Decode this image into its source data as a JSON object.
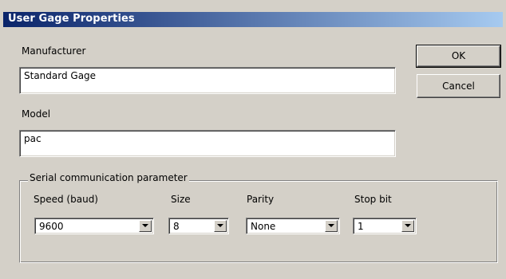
{
  "window": {
    "title": "User Gage Properties"
  },
  "manufacturer": {
    "label": "Manufacturer",
    "value": "Standard Gage"
  },
  "model": {
    "label": "Model",
    "value": "pac"
  },
  "buttons": {
    "ok": "OK",
    "cancel": "Cancel"
  },
  "serial": {
    "legend": "Serial communication parameter",
    "speed": {
      "label": "Speed (baud)",
      "value": "9600"
    },
    "size": {
      "label": "Size",
      "value": "8"
    },
    "parity": {
      "label": "Parity",
      "value": "None"
    },
    "stop_bit": {
      "label": "Stop bit",
      "value": "1"
    }
  },
  "colors": {
    "titlebar_start": "#0a246a",
    "titlebar_end": "#a6caf0",
    "dialog_face": "#d4d0c8"
  }
}
